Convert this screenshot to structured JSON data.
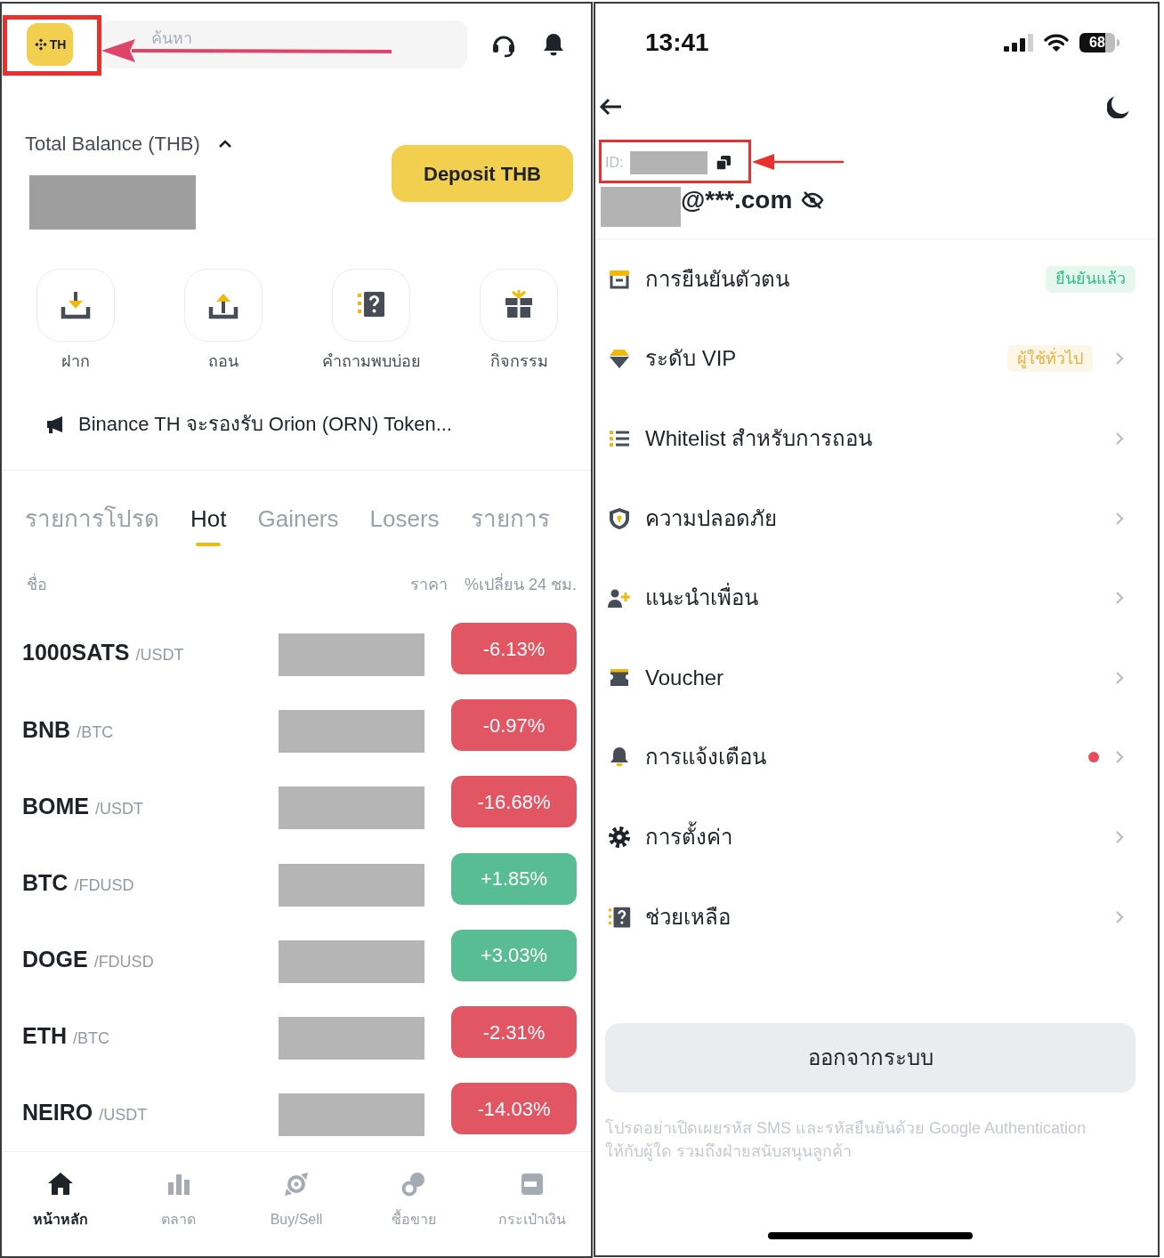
{
  "left_screen": {
    "header": {
      "logo_text": "TH",
      "search": {
        "placeholder": "ค้นหา"
      }
    },
    "balance": {
      "label": "Total Balance (THB)",
      "expanded": true,
      "deposit_button": "Deposit THB"
    },
    "quick_actions": [
      {
        "label": "ฝาก",
        "kind": "deposit"
      },
      {
        "label": "ถอน",
        "kind": "withdraw"
      },
      {
        "label": "คำถามพบบ่อย",
        "kind": "faq"
      },
      {
        "label": "กิจกรรม",
        "kind": "rewards"
      }
    ],
    "announcement": "Binance TH จะรองรับ Orion (ORN) Token...",
    "market_tabs": [
      {
        "label": "รายการโปรด",
        "selected": false
      },
      {
        "label": "Hot",
        "selected": true
      },
      {
        "label": "Gainers",
        "selected": false
      },
      {
        "label": "Losers",
        "selected": false
      },
      {
        "label": "รายการ",
        "selected": false
      }
    ],
    "market_table": {
      "columns": [
        "ชื่อ",
        "ราคา",
        "%เปลี่ยน 24 ชม."
      ],
      "rows": [
        {
          "symbol": "1000SATS",
          "quote": "/USDT",
          "change": "-6.13%",
          "color": "#e25563"
        },
        {
          "symbol": "BNB",
          "quote": "/BTC",
          "change": "-0.97%",
          "color": "#e25563"
        },
        {
          "symbol": "BOME",
          "quote": "/USDT",
          "change": "-16.68%",
          "color": "#e25563"
        },
        {
          "symbol": "BTC",
          "quote": "/FDUSD",
          "change": "+1.85%",
          "color": "#58bd93"
        },
        {
          "symbol": "DOGE",
          "quote": "/FDUSD",
          "change": "+3.03%",
          "color": "#58bd93"
        },
        {
          "symbol": "ETH",
          "quote": "/BTC",
          "change": "-2.31%",
          "color": "#e25563"
        },
        {
          "symbol": "NEIRO",
          "quote": "/USDT",
          "change": "-14.03%",
          "color": "#e25563"
        }
      ]
    },
    "bottom_nav": [
      {
        "label": "หน้าหลัก",
        "kind": "home",
        "selected": true
      },
      {
        "label": "ตลาด",
        "kind": "markets",
        "selected": false
      },
      {
        "label": "Buy/Sell",
        "kind": "buy_sell",
        "selected": false
      },
      {
        "label": "ซื้อขาย",
        "kind": "trade",
        "selected": false
      },
      {
        "label": "กระเป๋าเงิน",
        "kind": "wallet",
        "selected": false
      }
    ]
  },
  "right_screen": {
    "status_bar": {
      "time": "13:41",
      "battery": "68"
    },
    "profile": {
      "id_label": "ID:",
      "email": "@***.com",
      "email_masked": true
    },
    "menu": [
      {
        "label": "การยืนยันตัวตน",
        "kind": "verify",
        "badge": {
          "text": "ยืนยันแล้ว",
          "color": "#2ebd85"
        },
        "unread": false,
        "chevron": false
      },
      {
        "label": "ระดับ VIP",
        "kind": "vip",
        "badge": {
          "text": "ผู้ใช้ทั่วไป",
          "color": "#e3b341"
        },
        "unread": false,
        "chevron": true
      },
      {
        "label": "Whitelist สำหรับการถอน",
        "kind": "whitelist",
        "unread": false,
        "chevron": true
      },
      {
        "label": "ความปลอดภัย",
        "kind": "security",
        "unread": false,
        "chevron": true
      },
      {
        "label": "แนะนำเพื่อน",
        "kind": "referral",
        "unread": false,
        "chevron": true
      },
      {
        "label": "Voucher",
        "kind": "voucher",
        "unread": false,
        "chevron": true
      },
      {
        "label": "การแจ้งเตือน",
        "kind": "notifications",
        "unread": true,
        "chevron": true
      },
      {
        "label": "การตั้งค่า",
        "kind": "settings",
        "unread": false,
        "chevron": true
      },
      {
        "label": "ช่วยเหลือ",
        "kind": "help",
        "unread": false,
        "chevron": true
      }
    ],
    "logout_button": "ออกจากระบบ",
    "footnote": "โปรดอย่าเปิดเผยรหัส SMS และรหัสยืนยันด้วย Google Authentication ให้กับผู้ใด รวมถึงฝ่ายสนับสนุนลูกค้า"
  }
}
